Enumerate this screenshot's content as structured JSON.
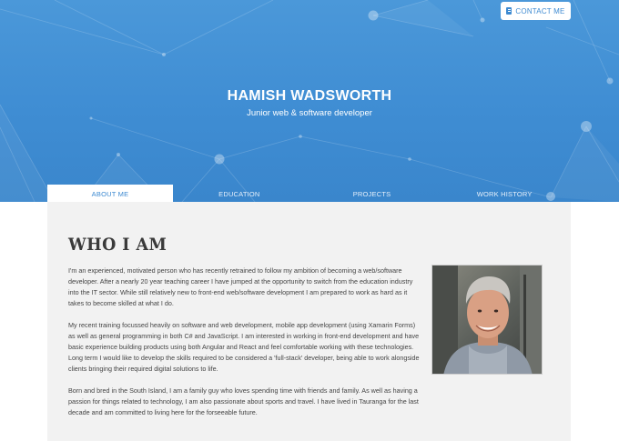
{
  "header": {
    "contact_label": "CONTACT ME",
    "name": "HAMISH WADSWORTH",
    "subtitle": "Junior web & software developer"
  },
  "tabs": [
    {
      "label": "ABOUT ME",
      "active": true
    },
    {
      "label": "EDUCATION",
      "active": false
    },
    {
      "label": "PROJECTS",
      "active": false
    },
    {
      "label": "WORK HISTORY",
      "active": false
    }
  ],
  "about": {
    "heading": "WHO I AM",
    "paragraphs": [
      "I'm an experienced, motivated person who has recently retrained to follow my ambition of becoming a web/software developer. After a nearly 20 year teaching career I have jumped at the opportunity to switch from the education industry into the IT sector. While still relatively new to front-end web/software development I am prepared to work as hard as it takes to become skilled at what I do.",
      "My recent training focussed heavily on software and web development, mobile app development (using Xamarin Forms) as well as general programming in both C# and JavaScript. I am interested in working in front-end development and have basic experience building products using both Angular and React and feel comfortable working with these technologies. Long term I would like to develop the skills required to be considered a 'full-stack' developer, being able to work alongside clients bringing their required digital solutions to life.",
      "Born and bred in the South Island, I am a family guy who loves spending time with friends and family. As well as having a passion for things related to technology, I am also passionate about sports and travel. I have lived in Tauranga for the last decade and am committed to living here for the forseeable future."
    ]
  },
  "colors": {
    "hero_blue": "#3f8dd3",
    "accent": "#3d8ad1",
    "panel_bg": "#f2f2f2"
  },
  "icons": {
    "contact": "address-book-icon"
  }
}
